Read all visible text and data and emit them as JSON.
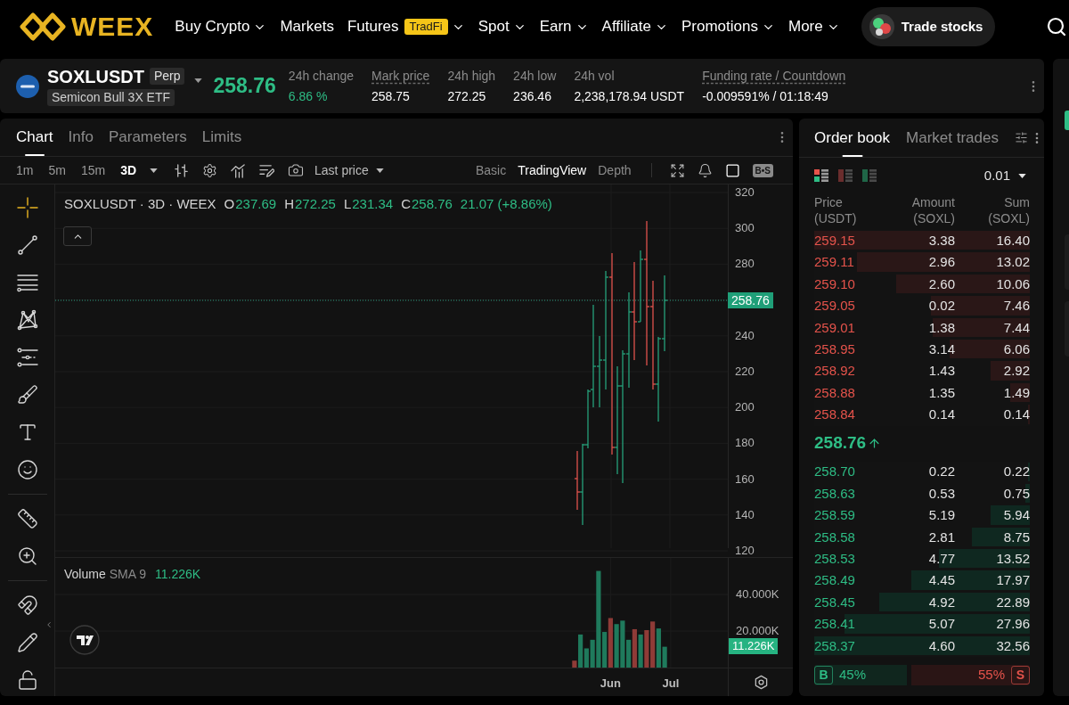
{
  "nav": {
    "logo": "WEEX",
    "items": [
      {
        "label": "Buy Crypto",
        "dropdown": true
      },
      {
        "label": "Markets",
        "dropdown": false
      },
      {
        "label": "Futures",
        "badge": "TradFi",
        "dropdown": true
      },
      {
        "label": "Spot",
        "dropdown": true
      },
      {
        "label": "Earn",
        "dropdown": true
      },
      {
        "label": "Affiliate",
        "dropdown": true
      },
      {
        "label": "Promotions",
        "dropdown": true
      },
      {
        "label": "More",
        "dropdown": true
      }
    ],
    "cta": "Trade stocks"
  },
  "ticker": {
    "symbol": "SOXLUSDT",
    "contract_type": "Perp",
    "name": "Semicon Bull 3X ETF",
    "price": "258.76",
    "rising": true,
    "stats": [
      {
        "label": "24h change",
        "value": "6.86 %",
        "kind": "change",
        "underlined": false
      },
      {
        "label": "Mark price",
        "value": "258.75",
        "kind": "plain",
        "underlined": true
      },
      {
        "label": "24h high",
        "value": "272.25",
        "kind": "plain",
        "underlined": false
      },
      {
        "label": "24h low",
        "value": "236.46",
        "kind": "plain",
        "underlined": false
      },
      {
        "label": "24h vol",
        "value": "2,238,178.94 USDT",
        "kind": "plain",
        "underlined": false
      },
      {
        "label": "Funding rate / Countdown",
        "value": "-0.009591% / 01:18:49",
        "kind": "plain",
        "underlined": true
      }
    ]
  },
  "chart_panel": {
    "tabs": [
      {
        "label": "Chart",
        "selected": true
      },
      {
        "label": "Info",
        "selected": false
      },
      {
        "label": "Parameters",
        "selected": false
      },
      {
        "label": "Limits",
        "selected": false
      }
    ],
    "intervals": [
      {
        "label": "1m",
        "selected": false
      },
      {
        "label": "5m",
        "selected": false
      },
      {
        "label": "15m",
        "selected": false
      },
      {
        "label": "3D",
        "selected": true
      }
    ],
    "price_source": "Last price",
    "views": [
      {
        "label": "Basic",
        "selected": false
      },
      {
        "label": "TradingView",
        "selected": true
      },
      {
        "label": "Depth",
        "selected": false
      }
    ],
    "buy_sell_toggle": "B•S",
    "tool_groups": [
      {
        "tools": [
          {
            "kind": "crosshair",
            "selected": true
          },
          {
            "kind": "trend_line",
            "selected": false
          },
          {
            "kind": "fib",
            "selected": false
          },
          {
            "kind": "pattern",
            "selected": false
          },
          {
            "kind": "projection",
            "selected": false
          },
          {
            "kind": "brush",
            "selected": false
          },
          {
            "kind": "text",
            "selected": false
          },
          {
            "kind": "emoji",
            "selected": false
          }
        ]
      },
      {
        "tools": [
          {
            "kind": "ruler",
            "selected": false
          },
          {
            "kind": "zoom",
            "selected": false
          }
        ]
      },
      {
        "tools": [
          {
            "kind": "magnet",
            "selected": false
          },
          {
            "kind": "lock_drawing",
            "selected": false
          },
          {
            "kind": "unlock",
            "selected": false
          }
        ]
      }
    ],
    "legend": {
      "title": "SOXLUSDT · 3D · WEEX",
      "fields": [
        {
          "key": "O",
          "value": "237.69"
        },
        {
          "key": "H",
          "value": "272.25"
        },
        {
          "key": "L",
          "value": "231.34"
        },
        {
          "key": "C",
          "value": "258.76"
        }
      ],
      "change": "21.07 (+8.86%)"
    },
    "price_axis": [
      {
        "kind": "tick",
        "label": "320"
      },
      {
        "kind": "tick",
        "label": "300"
      },
      {
        "kind": "tick",
        "label": "280"
      },
      {
        "kind": "last_price",
        "label": "258.76"
      },
      {
        "kind": "tick",
        "label": "240"
      },
      {
        "kind": "tick",
        "label": "220"
      },
      {
        "kind": "tick",
        "label": "200"
      },
      {
        "kind": "tick",
        "label": "180"
      },
      {
        "kind": "tick",
        "label": "160"
      },
      {
        "kind": "tick",
        "label": "140"
      },
      {
        "kind": "tick",
        "label": "120"
      }
    ],
    "volume": {
      "title": "Volume",
      "indicator": "SMA 9",
      "indicator_value": "11.226K",
      "last_value": "11.226K",
      "chart_data": {
        "type": "bar",
        "stacked": true,
        "categories": [
          null,
          null,
          null,
          null,
          null,
          null,
          null,
          null,
          null,
          null,
          null,
          null,
          null,
          null,
          null,
          null,
          null,
          null,
          null,
          null,
          null,
          null,
          null,
          null,
          null,
          null,
          null,
          null,
          null,
          null,
          null,
          null,
          null,
          null,
          null,
          null,
          null,
          null,
          null,
          null,
          null,
          null,
          null,
          null,
          null,
          null,
          null,
          null,
          null,
          null,
          null,
          null,
          null,
          null,
          null,
          null,
          null,
          null,
          null,
          null,
          null,
          null,
          null,
          null,
          "Jun",
          null,
          null,
          null,
          null,
          null,
          null,
          null,
          null,
          null,
          "Jul",
          null,
          null,
          null,
          null,
          null,
          null,
          null,
          null,
          null
        ],
        "series": [
          {
            "color": "#1f7a5c",
            "values": [
              null,
              null,
              null,
              null,
              null,
              null,
              null,
              null,
              null,
              null,
              null,
              null,
              null,
              null,
              null,
              null,
              null,
              null,
              null,
              null,
              null,
              null,
              null,
              null,
              null,
              null,
              null,
              null,
              null,
              null,
              null,
              null,
              null,
              null,
              null,
              null,
              null,
              null,
              null,
              null,
              null,
              null,
              null,
              null,
              null,
              null,
              null,
              null,
              null,
              null,
              null,
              null,
              null,
              null,
              null,
              null,
              null,
              null,
              0,
              18.1,
              10.5,
              15.2,
              52.9,
              19.5,
              0,
              23.8,
              25.7,
              15.2,
              0,
              18.1,
              0,
              0,
              21.4,
              11.4,
              null,
              null,
              null,
              null,
              null,
              null,
              null,
              null,
              null,
              null
            ]
          },
          {
            "color": "#8f3b37",
            "values": [
              null,
              null,
              null,
              null,
              null,
              null,
              null,
              null,
              null,
              null,
              null,
              null,
              null,
              null,
              null,
              null,
              null,
              null,
              null,
              null,
              null,
              null,
              null,
              null,
              null,
              null,
              null,
              null,
              null,
              null,
              null,
              null,
              null,
              null,
              null,
              null,
              null,
              null,
              null,
              null,
              null,
              null,
              null,
              null,
              null,
              null,
              null,
              null,
              null,
              null,
              null,
              null,
              null,
              null,
              null,
              null,
              null,
              null,
              3.8,
              0,
              0,
              0,
              0,
              0,
              27.1,
              0,
              0,
              0,
              21.0,
              0,
              20.5,
              25.2,
              0,
              0,
              null,
              null,
              null,
              null,
              null,
              null,
              null,
              null,
              null,
              null
            ]
          }
        ],
        "ylim": [
          0,
          60
        ],
        "yticks": [
          {
            "value": 20,
            "label": "20.000K"
          },
          {
            "value": 40,
            "label": "40.000K"
          }
        ]
      }
    }
  },
  "order_book": {
    "tabs": [
      {
        "label": "Order book",
        "selected": true
      },
      {
        "label": "Market trades",
        "selected": false
      }
    ],
    "layouts": [
      {
        "kind": "both",
        "selected": true
      },
      {
        "kind": "asks",
        "selected": false
      },
      {
        "kind": "bids",
        "selected": false
      }
    ],
    "precision": "0.01",
    "columns": [
      "Price (USDT)",
      "Amount (SOXL)",
      "Sum (SOXL)"
    ],
    "asks": [
      {
        "price": "259.15",
        "amount": "3.38",
        "sum": "16.40",
        "level": 1.0
      },
      {
        "price": "259.11",
        "amount": "2.96",
        "sum": "13.02",
        "level": 0.8
      },
      {
        "price": "259.10",
        "amount": "2.60",
        "sum": "10.06",
        "level": 0.62
      },
      {
        "price": "259.05",
        "amount": "0.02",
        "sum": "7.46",
        "level": 0.46
      },
      {
        "price": "259.01",
        "amount": "1.38",
        "sum": "7.44",
        "level": 0.45
      },
      {
        "price": "258.95",
        "amount": "3.14",
        "sum": "6.06",
        "level": 0.37
      },
      {
        "price": "258.92",
        "amount": "1.43",
        "sum": "2.92",
        "level": 0.18
      },
      {
        "price": "258.88",
        "amount": "1.35",
        "sum": "1.49",
        "level": 0.09
      },
      {
        "price": "258.84",
        "amount": "0.14",
        "sum": "0.14",
        "level": 0.01
      }
    ],
    "last_price": {
      "value": "258.76",
      "rising": true
    },
    "bids": [
      {
        "price": "258.70",
        "amount": "0.22",
        "sum": "0.22",
        "level": 0.01
      },
      {
        "price": "258.63",
        "amount": "0.53",
        "sum": "0.75",
        "level": 0.02
      },
      {
        "price": "258.59",
        "amount": "5.19",
        "sum": "5.94",
        "level": 0.18
      },
      {
        "price": "258.58",
        "amount": "2.81",
        "sum": "8.75",
        "level": 0.27
      },
      {
        "price": "258.53",
        "amount": "4.77",
        "sum": "13.52",
        "level": 0.42
      },
      {
        "price": "258.49",
        "amount": "4.45",
        "sum": "17.97",
        "level": 0.55
      },
      {
        "price": "258.45",
        "amount": "4.92",
        "sum": "22.89",
        "level": 0.7
      },
      {
        "price": "258.41",
        "amount": "5.07",
        "sum": "27.96",
        "level": 0.86
      },
      {
        "price": "258.37",
        "amount": "4.60",
        "sum": "32.56",
        "level": 1.0
      }
    ],
    "ratio": {
      "buy": {
        "label": "B",
        "percent": "45%",
        "level": 0.45
      },
      "sell": {
        "label": "S",
        "percent": "55%"
      }
    }
  }
}
